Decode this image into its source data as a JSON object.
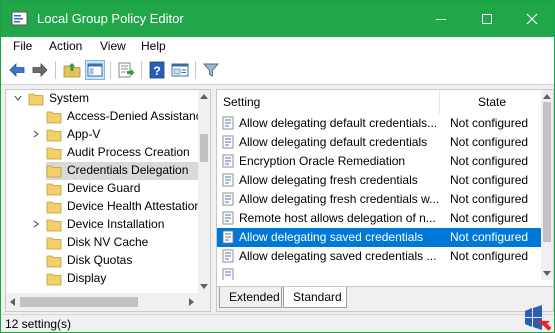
{
  "window": {
    "title": "Local Group Policy Editor",
    "accent_color": "#21a74a"
  },
  "menubar": {
    "items": [
      "File",
      "Action",
      "View",
      "Help"
    ]
  },
  "toolbar": {
    "buttons": [
      "back-arrow-icon",
      "forward-arrow-icon",
      "up-folder-icon",
      "show-hide-tree-icon",
      "export-list-icon",
      "help-icon",
      "properties-icon",
      "filter-icon"
    ]
  },
  "tree": {
    "root": "System",
    "items": [
      {
        "label": "Access-Denied Assistance",
        "expandable": false
      },
      {
        "label": "App-V",
        "expandable": true
      },
      {
        "label": "Audit Process Creation",
        "expandable": false
      },
      {
        "label": "Credentials Delegation",
        "expandable": false,
        "selected": true
      },
      {
        "label": "Device Guard",
        "expandable": false
      },
      {
        "label": "Device Health Attestation",
        "expandable": false
      },
      {
        "label": "Device Installation",
        "expandable": true
      },
      {
        "label": "Disk NV Cache",
        "expandable": false
      },
      {
        "label": "Disk Quotas",
        "expandable": false
      },
      {
        "label": "Display",
        "expandable": false
      }
    ]
  },
  "detail": {
    "columns": {
      "setting": "Setting",
      "state": "State"
    },
    "rows": [
      {
        "name": "Allow delegating default credentials...",
        "state": "Not configured"
      },
      {
        "name": "Allow delegating default credentials",
        "state": "Not configured"
      },
      {
        "name": "Encryption Oracle Remediation",
        "state": "Not configured"
      },
      {
        "name": "Allow delegating fresh credentials",
        "state": "Not configured"
      },
      {
        "name": "Allow delegating fresh credentials w...",
        "state": "Not configured"
      },
      {
        "name": "Remote host allows delegation of n...",
        "state": "Not configured"
      },
      {
        "name": "Allow delegating saved credentials",
        "state": "Not configured",
        "selected": true
      },
      {
        "name": "Allow delegating saved credentials ...",
        "state": "Not configured"
      }
    ],
    "tabs": [
      "Extended",
      "Standard"
    ],
    "active_tab": "Standard"
  },
  "statusbar": {
    "text": "12 setting(s)"
  },
  "colors": {
    "selection": "#0078d7",
    "tree_selection": "#d9d9d9"
  }
}
